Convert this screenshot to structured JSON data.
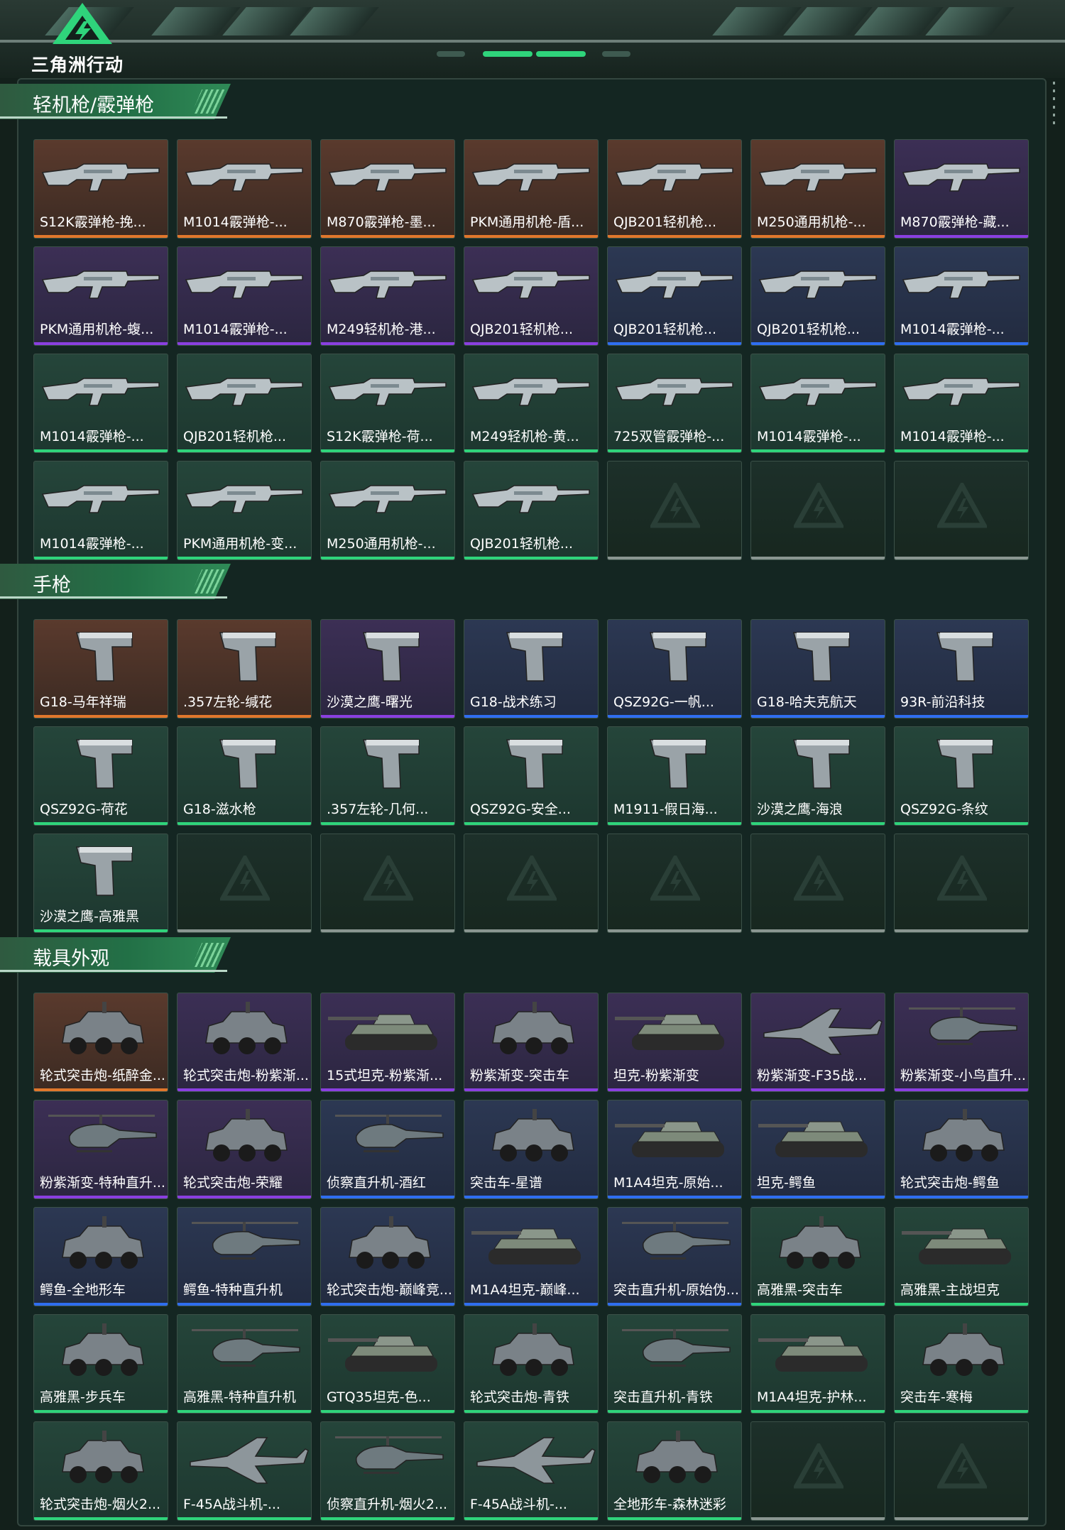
{
  "app": {
    "logo_text": "三角洲行动"
  },
  "colors": {
    "orange": "#e0772c",
    "purple": "#8a3fe0",
    "blue": "#2f6ef0",
    "green": "#2fd47b",
    "empty": "#8a9691"
  },
  "sections": [
    {
      "title": "轻机枪/霰弹枪",
      "items": [
        {
          "label": "S12K霰弹枪-挽...",
          "rarity": "orange",
          "kind": "gun"
        },
        {
          "label": "M1014霰弹枪-...",
          "rarity": "orange",
          "kind": "gun"
        },
        {
          "label": "M870霰弹枪-墨...",
          "rarity": "orange",
          "kind": "gun"
        },
        {
          "label": "PKM通用机枪-盾...",
          "rarity": "orange",
          "kind": "gun"
        },
        {
          "label": "QJB201轻机枪...",
          "rarity": "orange",
          "kind": "gun"
        },
        {
          "label": "M250通用机枪-...",
          "rarity": "orange",
          "kind": "gun"
        },
        {
          "label": "M870霰弹枪-藏...",
          "rarity": "purple",
          "kind": "gun"
        },
        {
          "label": "PKM通用机枪-蝮...",
          "rarity": "purple",
          "kind": "gun"
        },
        {
          "label": "M1014霰弹枪-...",
          "rarity": "purple",
          "kind": "gun"
        },
        {
          "label": "M249轻机枪-港...",
          "rarity": "purple",
          "kind": "gun"
        },
        {
          "label": "QJB201轻机枪...",
          "rarity": "purple",
          "kind": "gun"
        },
        {
          "label": "QJB201轻机枪...",
          "rarity": "blue",
          "kind": "gun"
        },
        {
          "label": "QJB201轻机枪...",
          "rarity": "blue",
          "kind": "gun"
        },
        {
          "label": "M1014霰弹枪-...",
          "rarity": "blue",
          "kind": "gun"
        },
        {
          "label": "M1014霰弹枪-...",
          "rarity": "green",
          "kind": "gun"
        },
        {
          "label": "QJB201轻机枪...",
          "rarity": "green",
          "kind": "gun"
        },
        {
          "label": "S12K霰弹枪-荷...",
          "rarity": "green",
          "kind": "gun"
        },
        {
          "label": "M249轻机枪-黄...",
          "rarity": "green",
          "kind": "gun"
        },
        {
          "label": "725双管霰弹枪-...",
          "rarity": "green",
          "kind": "gun"
        },
        {
          "label": "M1014霰弹枪-...",
          "rarity": "green",
          "kind": "gun"
        },
        {
          "label": "M1014霰弹枪-...",
          "rarity": "green",
          "kind": "gun"
        },
        {
          "label": "M1014霰弹枪-...",
          "rarity": "green",
          "kind": "gun"
        },
        {
          "label": "PKM通用机枪-变...",
          "rarity": "green",
          "kind": "gun"
        },
        {
          "label": "M250通用机枪-...",
          "rarity": "green",
          "kind": "gun"
        },
        {
          "label": "QJB201轻机枪...",
          "rarity": "green",
          "kind": "gun"
        },
        {
          "label": "",
          "rarity": "empty",
          "kind": "empty"
        },
        {
          "label": "",
          "rarity": "empty",
          "kind": "empty"
        },
        {
          "label": "",
          "rarity": "empty",
          "kind": "empty"
        }
      ]
    },
    {
      "title": "手枪",
      "items": [
        {
          "label": "G18-马年祥瑞",
          "rarity": "orange",
          "kind": "pistol"
        },
        {
          "label": ".357左轮-缄花",
          "rarity": "orange",
          "kind": "pistol"
        },
        {
          "label": "沙漠之鹰-曙光",
          "rarity": "purple",
          "kind": "pistol"
        },
        {
          "label": "G18-战术练习",
          "rarity": "blue",
          "kind": "pistol"
        },
        {
          "label": "QSZ92G-一帆...",
          "rarity": "blue",
          "kind": "pistol"
        },
        {
          "label": "G18-哈夫克航天",
          "rarity": "blue",
          "kind": "pistol"
        },
        {
          "label": "93R-前沿科技",
          "rarity": "blue",
          "kind": "pistol"
        },
        {
          "label": "QSZ92G-荷花",
          "rarity": "green",
          "kind": "pistol"
        },
        {
          "label": "G18-滋水枪",
          "rarity": "green",
          "kind": "pistol"
        },
        {
          "label": ".357左轮-几何...",
          "rarity": "green",
          "kind": "pistol"
        },
        {
          "label": "QSZ92G-安全...",
          "rarity": "green",
          "kind": "pistol"
        },
        {
          "label": "M1911-假日海...",
          "rarity": "green",
          "kind": "pistol"
        },
        {
          "label": "沙漠之鹰-海浪",
          "rarity": "green",
          "kind": "pistol"
        },
        {
          "label": "QSZ92G-条纹",
          "rarity": "green",
          "kind": "pistol"
        },
        {
          "label": "沙漠之鹰-高雅黑",
          "rarity": "green",
          "kind": "pistol"
        },
        {
          "label": "",
          "rarity": "empty",
          "kind": "empty"
        },
        {
          "label": "",
          "rarity": "empty",
          "kind": "empty"
        },
        {
          "label": "",
          "rarity": "empty",
          "kind": "empty"
        },
        {
          "label": "",
          "rarity": "empty",
          "kind": "empty"
        },
        {
          "label": "",
          "rarity": "empty",
          "kind": "empty"
        },
        {
          "label": "",
          "rarity": "empty",
          "kind": "empty"
        }
      ]
    },
    {
      "title": "载具外观",
      "items": [
        {
          "label": "轮式突击炮-纸醉金...",
          "rarity": "orange",
          "kind": "vehicle"
        },
        {
          "label": "轮式突击炮-粉紫渐...",
          "rarity": "purple",
          "kind": "vehicle"
        },
        {
          "label": "15式坦克-粉紫渐...",
          "rarity": "purple",
          "kind": "tank"
        },
        {
          "label": "粉紫渐变-突击车",
          "rarity": "purple",
          "kind": "vehicle"
        },
        {
          "label": "坦克-粉紫渐变",
          "rarity": "purple",
          "kind": "tank"
        },
        {
          "label": "粉紫渐变-F35战...",
          "rarity": "purple",
          "kind": "jet"
        },
        {
          "label": "粉紫渐变-小鸟直升...",
          "rarity": "purple",
          "kind": "heli"
        },
        {
          "label": "粉紫渐变-特种直升...",
          "rarity": "purple",
          "kind": "heli"
        },
        {
          "label": "轮式突击炮-荣耀",
          "rarity": "purple",
          "kind": "vehicle"
        },
        {
          "label": "侦察直升机-酒红",
          "rarity": "blue",
          "kind": "heli"
        },
        {
          "label": "突击车-星谱",
          "rarity": "blue",
          "kind": "vehicle"
        },
        {
          "label": "M1A4坦克-原始...",
          "rarity": "blue",
          "kind": "tank"
        },
        {
          "label": "坦克-鳄鱼",
          "rarity": "blue",
          "kind": "tank"
        },
        {
          "label": "轮式突击炮-鳄鱼",
          "rarity": "blue",
          "kind": "vehicle"
        },
        {
          "label": "鳄鱼-全地形车",
          "rarity": "blue",
          "kind": "vehicle"
        },
        {
          "label": "鳄鱼-特种直升机",
          "rarity": "blue",
          "kind": "heli"
        },
        {
          "label": "轮式突击炮-巅峰竞...",
          "rarity": "blue",
          "kind": "vehicle"
        },
        {
          "label": "M1A4坦克-巅峰...",
          "rarity": "blue",
          "kind": "tank"
        },
        {
          "label": "突击直升机-原始伪...",
          "rarity": "blue",
          "kind": "heli"
        },
        {
          "label": "高雅黑-突击车",
          "rarity": "green",
          "kind": "vehicle"
        },
        {
          "label": "高雅黑-主战坦克",
          "rarity": "green",
          "kind": "tank"
        },
        {
          "label": "高雅黑-步兵车",
          "rarity": "green",
          "kind": "vehicle"
        },
        {
          "label": "高雅黑-特种直升机",
          "rarity": "green",
          "kind": "heli"
        },
        {
          "label": "GTQ35坦克-色...",
          "rarity": "green",
          "kind": "tank"
        },
        {
          "label": "轮式突击炮-青铁",
          "rarity": "green",
          "kind": "vehicle"
        },
        {
          "label": "突击直升机-青铁",
          "rarity": "green",
          "kind": "heli"
        },
        {
          "label": "M1A4坦克-护林...",
          "rarity": "green",
          "kind": "tank"
        },
        {
          "label": "突击车-寒梅",
          "rarity": "green",
          "kind": "vehicle"
        },
        {
          "label": "轮式突击炮-烟火2...",
          "rarity": "green",
          "kind": "vehicle"
        },
        {
          "label": "F-45A战斗机-...",
          "rarity": "green",
          "kind": "jet"
        },
        {
          "label": "侦察直升机-烟火2...",
          "rarity": "green",
          "kind": "heli"
        },
        {
          "label": "F-45A战斗机-...",
          "rarity": "green",
          "kind": "jet"
        },
        {
          "label": "全地形车-森林迷彩",
          "rarity": "green",
          "kind": "vehicle"
        },
        {
          "label": "",
          "rarity": "empty",
          "kind": "empty"
        },
        {
          "label": "",
          "rarity": "empty",
          "kind": "empty"
        }
      ]
    }
  ]
}
